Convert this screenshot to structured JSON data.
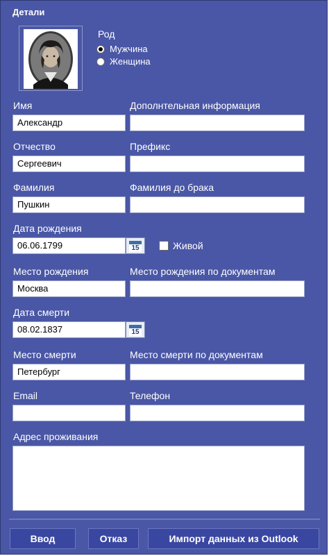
{
  "header": {
    "title": "Детали"
  },
  "gender": {
    "label": "Род",
    "options": [
      {
        "label": "Мужчина",
        "selected": true
      },
      {
        "label": "Женщина",
        "selected": false
      }
    ]
  },
  "fields": {
    "first_name": {
      "label": "Имя",
      "value": "Александр"
    },
    "extra_info": {
      "label": "Дополнтельная информация",
      "value": ""
    },
    "patronymic": {
      "label": "Отчество",
      "value": "Сергеевич"
    },
    "prefix": {
      "label": "Префикс",
      "value": ""
    },
    "last_name": {
      "label": "Фамилия",
      "value": "Пушкин"
    },
    "maiden_name": {
      "label": "Фамилия до брака",
      "value": ""
    },
    "birth_date": {
      "label": "Дата рождения",
      "value": "06.06.1799"
    },
    "alive": {
      "label": "Живой",
      "checked": false
    },
    "birth_place": {
      "label": "Место рождения",
      "value": "Москва"
    },
    "birth_place_docs": {
      "label": "Место рождения по документам",
      "value": ""
    },
    "death_date": {
      "label": "Дата смерти",
      "value": "08.02.1837"
    },
    "death_place": {
      "label": "Место смерти",
      "value": "Петербург"
    },
    "death_place_docs": {
      "label": "Место смерти по документам",
      "value": ""
    },
    "email": {
      "label": "Email",
      "value": ""
    },
    "phone": {
      "label": "Телефон",
      "value": ""
    },
    "address": {
      "label": "Адрес проживания",
      "value": ""
    }
  },
  "calendar_icon": {
    "name": "calendar-icon",
    "day": "15"
  },
  "buttons": {
    "ok": "Ввод",
    "cancel": "Отказ",
    "import": "Импорт данных из Outlook"
  },
  "colors": {
    "panel_bg": "#4a57a6",
    "button_bg": "#3a47a0",
    "text": "#ffffff"
  }
}
